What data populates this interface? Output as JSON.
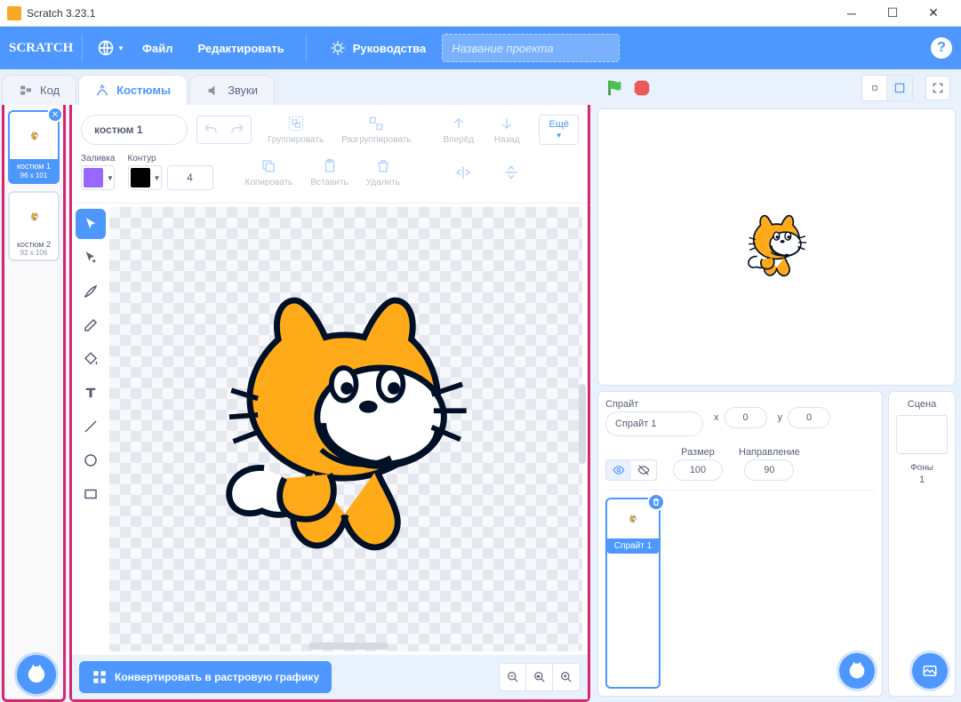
{
  "window": {
    "title": "Scratch 3.23.1"
  },
  "menu": {
    "file": "Файл",
    "edit": "Редактировать",
    "tutorials": "Руководства",
    "project_placeholder": "Название проекта"
  },
  "tabs": {
    "code": "Код",
    "costumes": "Костюмы",
    "sounds": "Звуки"
  },
  "costumes": [
    {
      "name": "костюм 1",
      "dims": "96 x 101"
    },
    {
      "name": "костюм 2",
      "dims": "92 x 106"
    }
  ],
  "editor": {
    "costume_name": "костюм 1",
    "fill_label": "Заливка",
    "outline_label": "Контур",
    "outline_width": "4",
    "fill_color": "#9966ff",
    "outline_color": "#000000",
    "group": "Группировать",
    "ungroup": "Разгруппировать",
    "forward": "Вперёд",
    "backward": "Назад",
    "more": "Ещё",
    "copy": "Копировать",
    "paste": "Вставить",
    "delete": "Удалить",
    "convert_bitmap": "Конвертировать в растровую графику"
  },
  "sprite_panel": {
    "sprite_label": "Спрайт",
    "name": "Спрайт 1",
    "x_label": "x",
    "x": "0",
    "y_label": "y",
    "y": "0",
    "size_label": "Размер",
    "size": "100",
    "dir_label": "Направление",
    "dir": "90"
  },
  "sprites": [
    {
      "name": "Спрайт 1"
    }
  ],
  "stage_panel": {
    "label": "Сцена",
    "backdrops_label": "Фоны",
    "backdrops_count": "1"
  }
}
